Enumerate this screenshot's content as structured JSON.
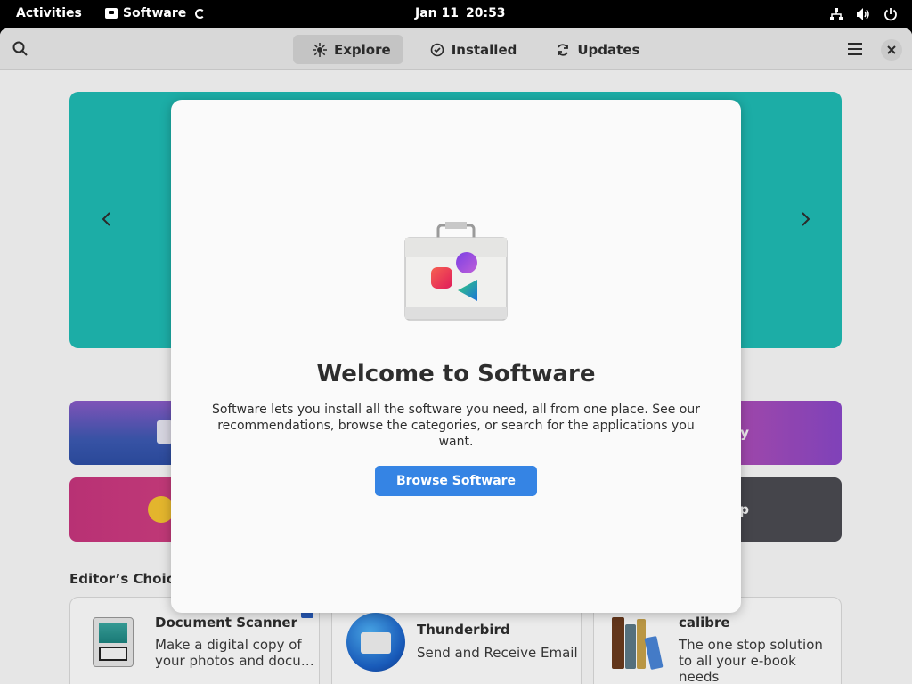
{
  "topbar": {
    "activities": "Activities",
    "app_name": "Software",
    "date": "Jan 11",
    "time": "20:53"
  },
  "headerbar": {
    "tabs": [
      {
        "label": "Explore",
        "icon": "explore-icon",
        "active": true
      },
      {
        "label": "Installed",
        "icon": "check-circle-icon",
        "active": false
      },
      {
        "label": "Updates",
        "icon": "refresh-icon",
        "active": false
      }
    ]
  },
  "content": {
    "categories": [
      {
        "label": ""
      },
      {
        "label": "y"
      },
      {
        "label": ""
      },
      {
        "label": "lop"
      }
    ],
    "editors_choice": "Editor’s Choice",
    "cards": [
      {
        "title": "Document Scanner",
        "desc": "Make a digital copy of your photos and docu…"
      },
      {
        "title": "Thunderbird",
        "desc": "Send and Receive Email"
      },
      {
        "title": "calibre",
        "desc": "The one stop solution to all your e-book needs"
      }
    ]
  },
  "dialog": {
    "title": "Welcome to Software",
    "body": "Software lets you install all the software you need, all from one place. See our recommendations, browse the categories, or search for the applications you want.",
    "button": "Browse Software"
  },
  "colors": {
    "accent": "#3584e4",
    "banner": "#1fbcb5"
  }
}
